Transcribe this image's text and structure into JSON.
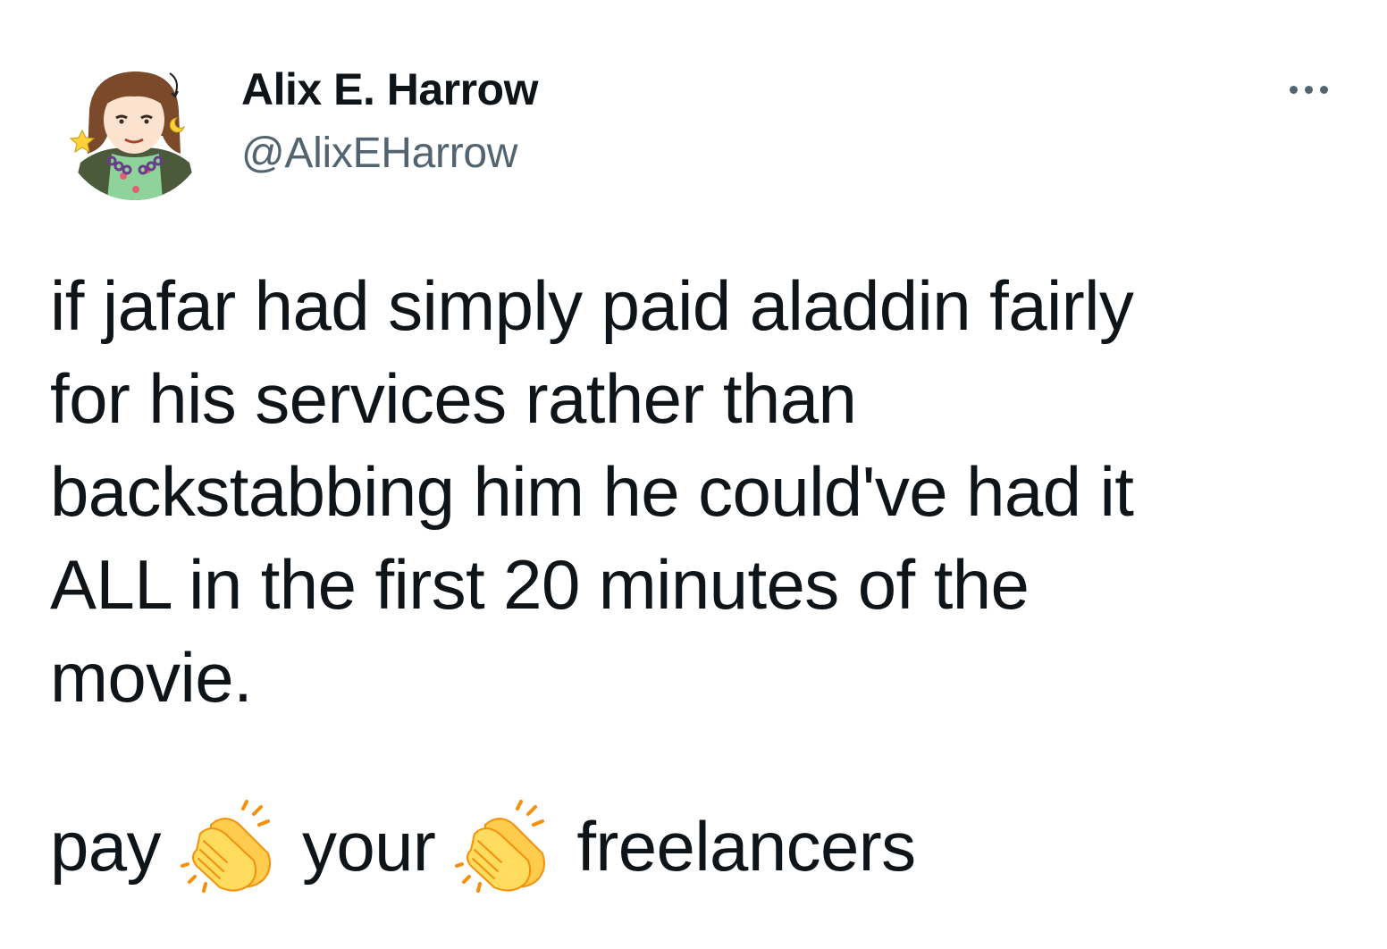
{
  "author": {
    "display_name": "Alix E. Harrow",
    "handle": "@AlixEHarrow",
    "avatar_icon": "illustrated-portrait-avatar"
  },
  "menu": {
    "icon": "more-options-icon"
  },
  "tweet": {
    "lines": [
      "if jafar had simply paid aladdin fairly",
      "for his services rather than",
      "backstabbing him he could've had it",
      "ALL in the first 20 minutes of the",
      "movie."
    ],
    "footer": {
      "word1": "pay",
      "word2": "your",
      "word3": "freelancers",
      "emoji_icon": "clapping-hands-emoji"
    }
  },
  "colors": {
    "text": "#0f1419",
    "secondary_text": "#536471",
    "background": "#ffffff",
    "clap_yellow": "#ffcc4d",
    "clap_outline": "#f4900c"
  }
}
